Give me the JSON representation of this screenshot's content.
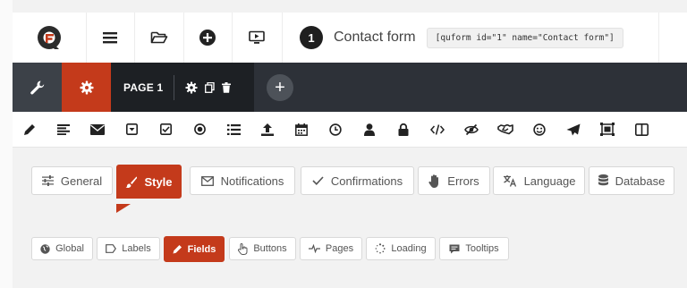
{
  "toolbar": {
    "form_number": "1",
    "form_title": "Contact form",
    "shortcode": "[quform id=\"1\" name=\"Contact form\"]"
  },
  "page_bar": {
    "page_label": "PAGE 1",
    "add_page": "+"
  },
  "field_icons": [
    "pencil-icon",
    "paragraph-icon",
    "envelope-icon",
    "dropdown-icon",
    "checkbox-icon",
    "radio-icon",
    "list-icon",
    "upload-icon",
    "calendar-icon",
    "clock-icon",
    "user-icon",
    "lock-icon",
    "code-icon",
    "eye-slash-icon",
    "handshake-icon",
    "smile-icon",
    "paper-plane-icon",
    "captcha-icon",
    "columns-icon"
  ],
  "settings_tabs": [
    {
      "label": "General",
      "icon": "sliders-icon"
    },
    {
      "label": "Style",
      "icon": "brush-icon",
      "active": true
    },
    {
      "label": "Notifications",
      "icon": "envelope-icon"
    },
    {
      "label": "Confirmations",
      "icon": "check-icon"
    },
    {
      "label": "Errors",
      "icon": "hand-icon"
    },
    {
      "label": "Language",
      "icon": "translate-icon"
    },
    {
      "label": "Database",
      "icon": "database-icon"
    }
  ],
  "style_subtabs": [
    {
      "label": "Global",
      "icon": "globe-icon"
    },
    {
      "label": "Labels",
      "icon": "tag-icon"
    },
    {
      "label": "Fields",
      "icon": "pencil-icon",
      "active": true
    },
    {
      "label": "Buttons",
      "icon": "pointer-icon"
    },
    {
      "label": "Pages",
      "icon": "pages-icon"
    },
    {
      "label": "Loading",
      "icon": "spinner-icon"
    },
    {
      "label": "Tooltips",
      "icon": "comment-icon"
    }
  ],
  "colors": {
    "accent": "#c43a1b",
    "dark_bar": "#2d3138",
    "page_tab": "#1d2024"
  }
}
